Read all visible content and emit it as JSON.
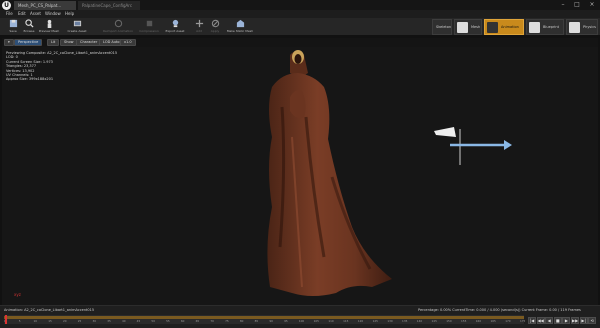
{
  "window": {
    "tab_active": "Mesh_PC_CS_Palpat...",
    "tab_inactive": "PalpatineCape_ConfigArc"
  },
  "menu": [
    "File",
    "Edit",
    "Asset",
    "Window",
    "Help"
  ],
  "toolbar": {
    "buttons": [
      {
        "label": "Save",
        "icon": "save-icon"
      },
      {
        "label": "Browse",
        "icon": "browse-icon"
      },
      {
        "label": "Preview Mesh",
        "icon": "preview-mesh-icon"
      },
      {
        "label": "Create Asset",
        "icon": "create-asset-icon"
      },
      {
        "label": "Reimport Animation",
        "icon": "reimport-icon"
      },
      {
        "label": "Compression",
        "icon": "compression-icon"
      },
      {
        "label": "Export Asset",
        "icon": "export-asset-icon"
      },
      {
        "label": "Add",
        "icon": "add-icon"
      },
      {
        "label": "Apply",
        "icon": "apply-icon"
      },
      {
        "label": "Make Static Mesh",
        "icon": "make-static-mesh-icon"
      }
    ],
    "modes": [
      {
        "label": "Skeleton",
        "active": false
      },
      {
        "label": "Mesh",
        "active": false
      },
      {
        "label": "Animation",
        "active": true
      },
      {
        "label": "Blueprint",
        "active": false
      },
      {
        "label": "Physics",
        "active": false
      }
    ]
  },
  "viewport_toolbar": {
    "perspective": "Perspective",
    "lit": "Lit",
    "show": "Show",
    "character": "Character",
    "lod": "LOD Auto",
    "speed": "x1.0"
  },
  "viewport_info": [
    "Previewing Composite: A2_2C_coClone_Libart1_animAccent015",
    "LOD: 0",
    "Current Screen Size: 1.973",
    "Triangles: 23,377",
    "Vertices: 13,902",
    "UV Channels: 1",
    "Approx Size: 399x188x201"
  ],
  "viewport_axis": "xyz",
  "timeline": {
    "animation_label": "Animation: A2_2C_coClone_Libart1_animAccent015",
    "status": "Percentage: 0.00%  CurrentTime: 0.000 / 4.000 (second(s))  Current Frame: 0.00 / 119 Frames",
    "ticks": [
      "0",
      "5",
      "10",
      "15",
      "20",
      "25",
      "30",
      "35",
      "40",
      "45",
      "50",
      "55",
      "60",
      "65",
      "70",
      "75",
      "80",
      "85",
      "90",
      "95",
      "100",
      "105",
      "110",
      "115",
      "120",
      "125",
      "130",
      "135",
      "140",
      "145",
      "150",
      "155",
      "160",
      "165",
      "170",
      "175"
    ],
    "playback_buttons": [
      "|◀",
      "◀◀",
      "◀",
      "■",
      "▶",
      "▶▶",
      "▶|",
      "⟲"
    ]
  },
  "colors": {
    "accent": "#c98a1c",
    "wind_arrow": "#8ab8e6",
    "robe": "#6a3420"
  }
}
